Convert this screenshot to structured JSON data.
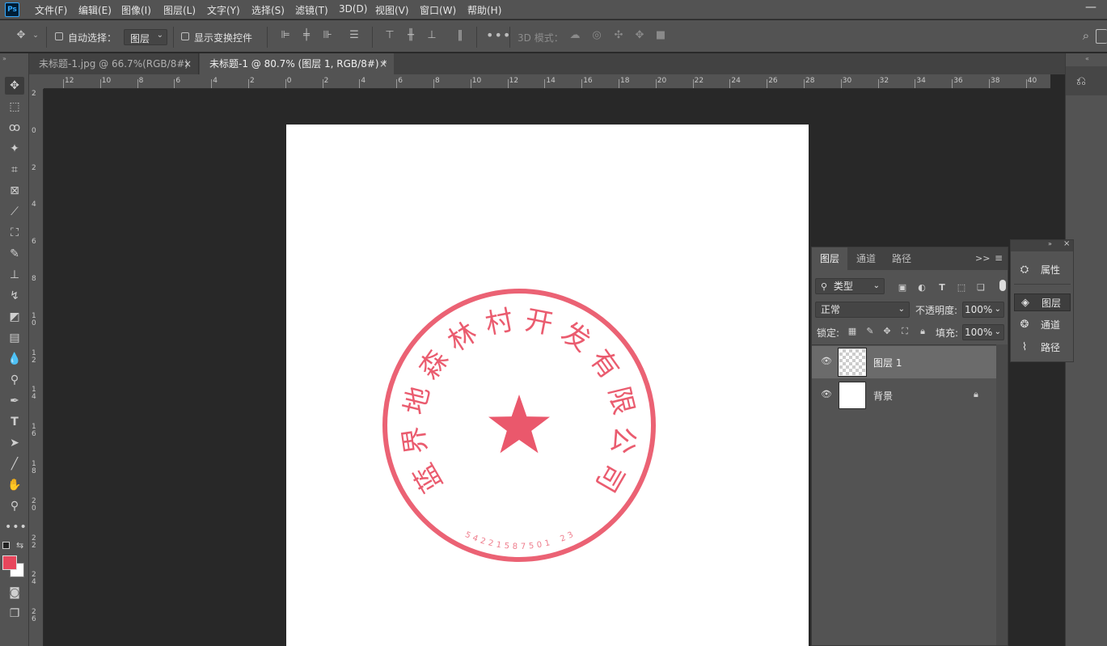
{
  "app": {
    "logo": "Ps",
    "window_min": "—"
  },
  "menu": [
    "文件(F)",
    "编辑(E)",
    "图像(I)",
    "图层(L)",
    "文字(Y)",
    "选择(S)",
    "滤镜(T)",
    "3D(D)",
    "视图(V)",
    "窗口(W)",
    "帮助(H)"
  ],
  "options": {
    "auto_select_label": "自动选择：",
    "auto_select_target": "图层",
    "show_transform_label": "显示变换控件",
    "mode_3d_label": "3D 模式："
  },
  "tabs": [
    {
      "label": "未标题-1.jpg @ 66.7%(RGB/8#)",
      "close": "×",
      "active": false
    },
    {
      "label": "未标题-1 @ 80.7% (图层 1, RGB/8#) *",
      "close": "×",
      "active": true
    }
  ],
  "ruler_top": [
    "12",
    "10",
    "8",
    "6",
    "4",
    "2",
    "0",
    "2",
    "4",
    "6",
    "8",
    "10",
    "12",
    "14",
    "16",
    "18",
    "20",
    "22",
    "24",
    "26",
    "28",
    "30",
    "32",
    "34",
    "36",
    "38",
    "40"
  ],
  "ruler_left": [
    "2",
    "0",
    "2",
    "4",
    "6",
    "8",
    "1 0",
    "1 2",
    "1 4",
    "1 6",
    "1 8",
    "2 0",
    "2 2",
    "2 4",
    "2 6"
  ],
  "stamp": {
    "arc_text": "蓝界地森林村开发有限公司",
    "code": "54221587501 23",
    "color": "#e8465c"
  },
  "colors": {
    "foreground": "#e8465c",
    "background": "#ffffff"
  },
  "layers_panel": {
    "tabs": [
      "图层",
      "通道",
      "路径"
    ],
    "filter_kind": "类型",
    "blend_mode": "正常",
    "opacity_label": "不透明度:",
    "opacity_value": "100%",
    "lock_label": "锁定:",
    "fill_label": "填充:",
    "fill_value": "100%",
    "layers": [
      {
        "name": "图层 1",
        "selected": true,
        "locked": false
      },
      {
        "name": "背景",
        "selected": false,
        "locked": true
      }
    ]
  },
  "mini_panel": {
    "items": [
      "属性",
      "图层",
      "通道",
      "路径"
    ]
  }
}
